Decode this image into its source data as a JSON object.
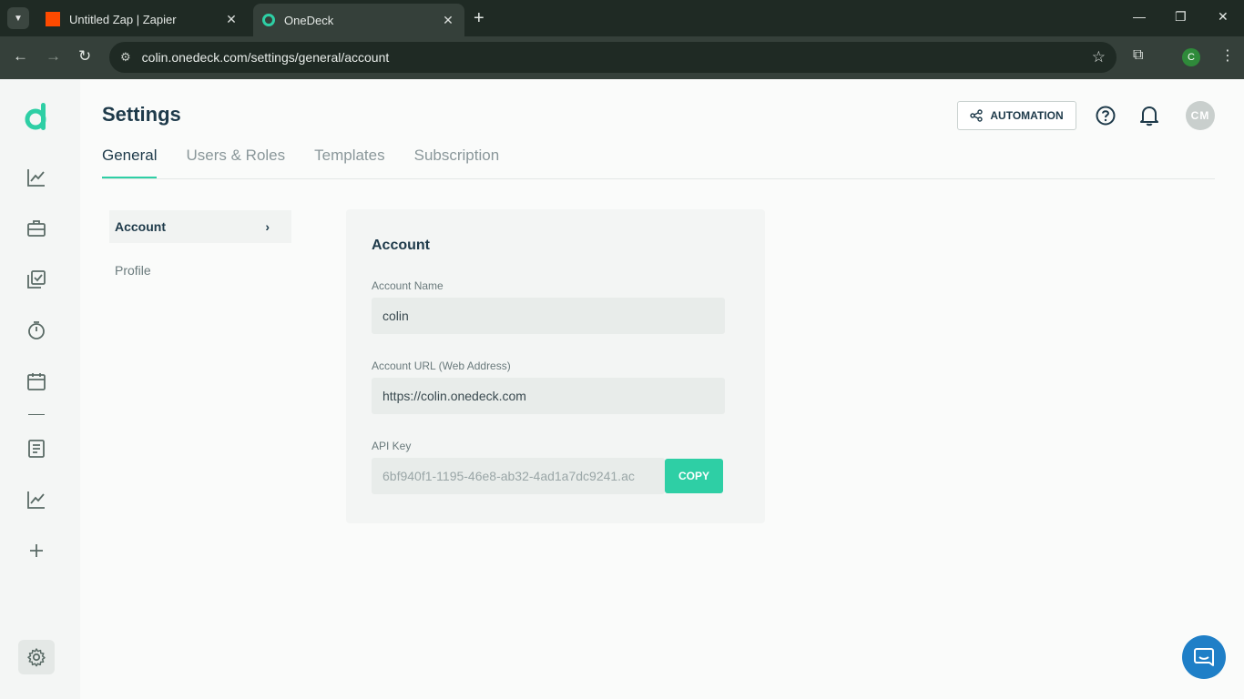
{
  "browser": {
    "tabs": [
      {
        "title": "Untitled Zap | Zapier",
        "active": false
      },
      {
        "title": "OneDeck",
        "active": true
      }
    ],
    "url": "colin.onedeck.com/settings/general/account",
    "profile_initial": "C"
  },
  "header": {
    "title": "Settings",
    "automation_label": "AUTOMATION",
    "avatar_initials": "CM"
  },
  "tabs": [
    "General",
    "Users & Roles",
    "Templates",
    "Subscription"
  ],
  "subnav": {
    "items": [
      "Account",
      "Profile"
    ]
  },
  "account": {
    "title": "Account",
    "name_label": "Account Name",
    "name_value": "colin",
    "url_label": "Account URL (Web Address)",
    "url_value": "https://colin.onedeck.com",
    "api_label": "API Key",
    "api_value": "6bf940f1-1195-46e8-ab32-4ad1a7dc9241.ac",
    "copy_label": "COPY"
  },
  "colors": {
    "accent": "#2ecfa5",
    "text_dark": "#1e3a4a",
    "chat": "#1f7fc7"
  }
}
